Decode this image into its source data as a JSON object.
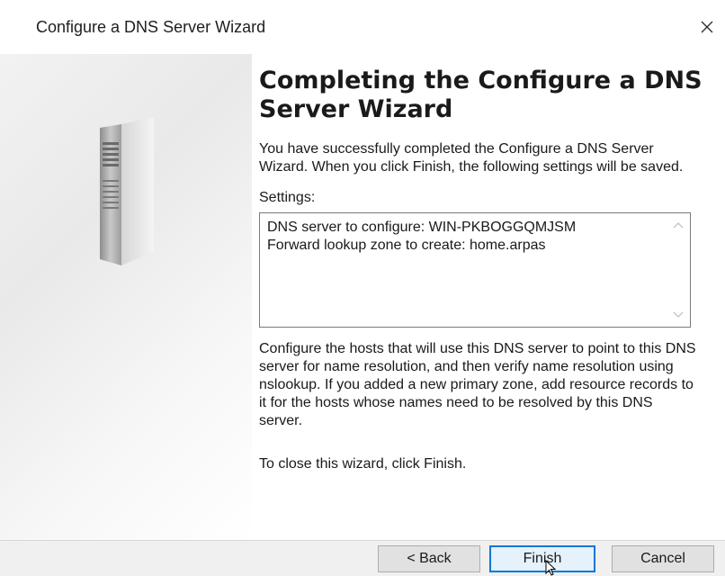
{
  "window": {
    "title": "Configure a DNS Server Wizard"
  },
  "page": {
    "heading_line1": "Completing the Configure a DNS",
    "heading_line2": "Server Wizard",
    "intro": "You have successfully completed the Configure a DNS Server Wizard. When you click Finish, the following settings will be saved.",
    "settings_label": "Settings:",
    "settings_lines": [
      "DNS server to configure: WIN-PKBOGGQMJSM",
      "Forward lookup zone to create: home.arpas"
    ],
    "body": "Configure the hosts that will use this DNS server to point to this DNS server for name resolution, and then verify name resolution using nslookup. If you added a new primary zone, add resource records to it for the hosts whose names need to be resolved by this DNS server.",
    "close_hint": "To close this wizard, click Finish."
  },
  "buttons": {
    "back": "< Back",
    "finish": "Finish",
    "cancel": "Cancel"
  },
  "icons": {
    "close": "close-icon",
    "server": "server-icon",
    "scroll_up": "chevron-up-icon",
    "scroll_down": "chevron-down-icon",
    "cursor": "mouse-pointer-icon"
  },
  "colors": {
    "accent": "#0078d7",
    "footer_bg": "#f0f0f0",
    "button_bg": "#e1e1e1"
  }
}
